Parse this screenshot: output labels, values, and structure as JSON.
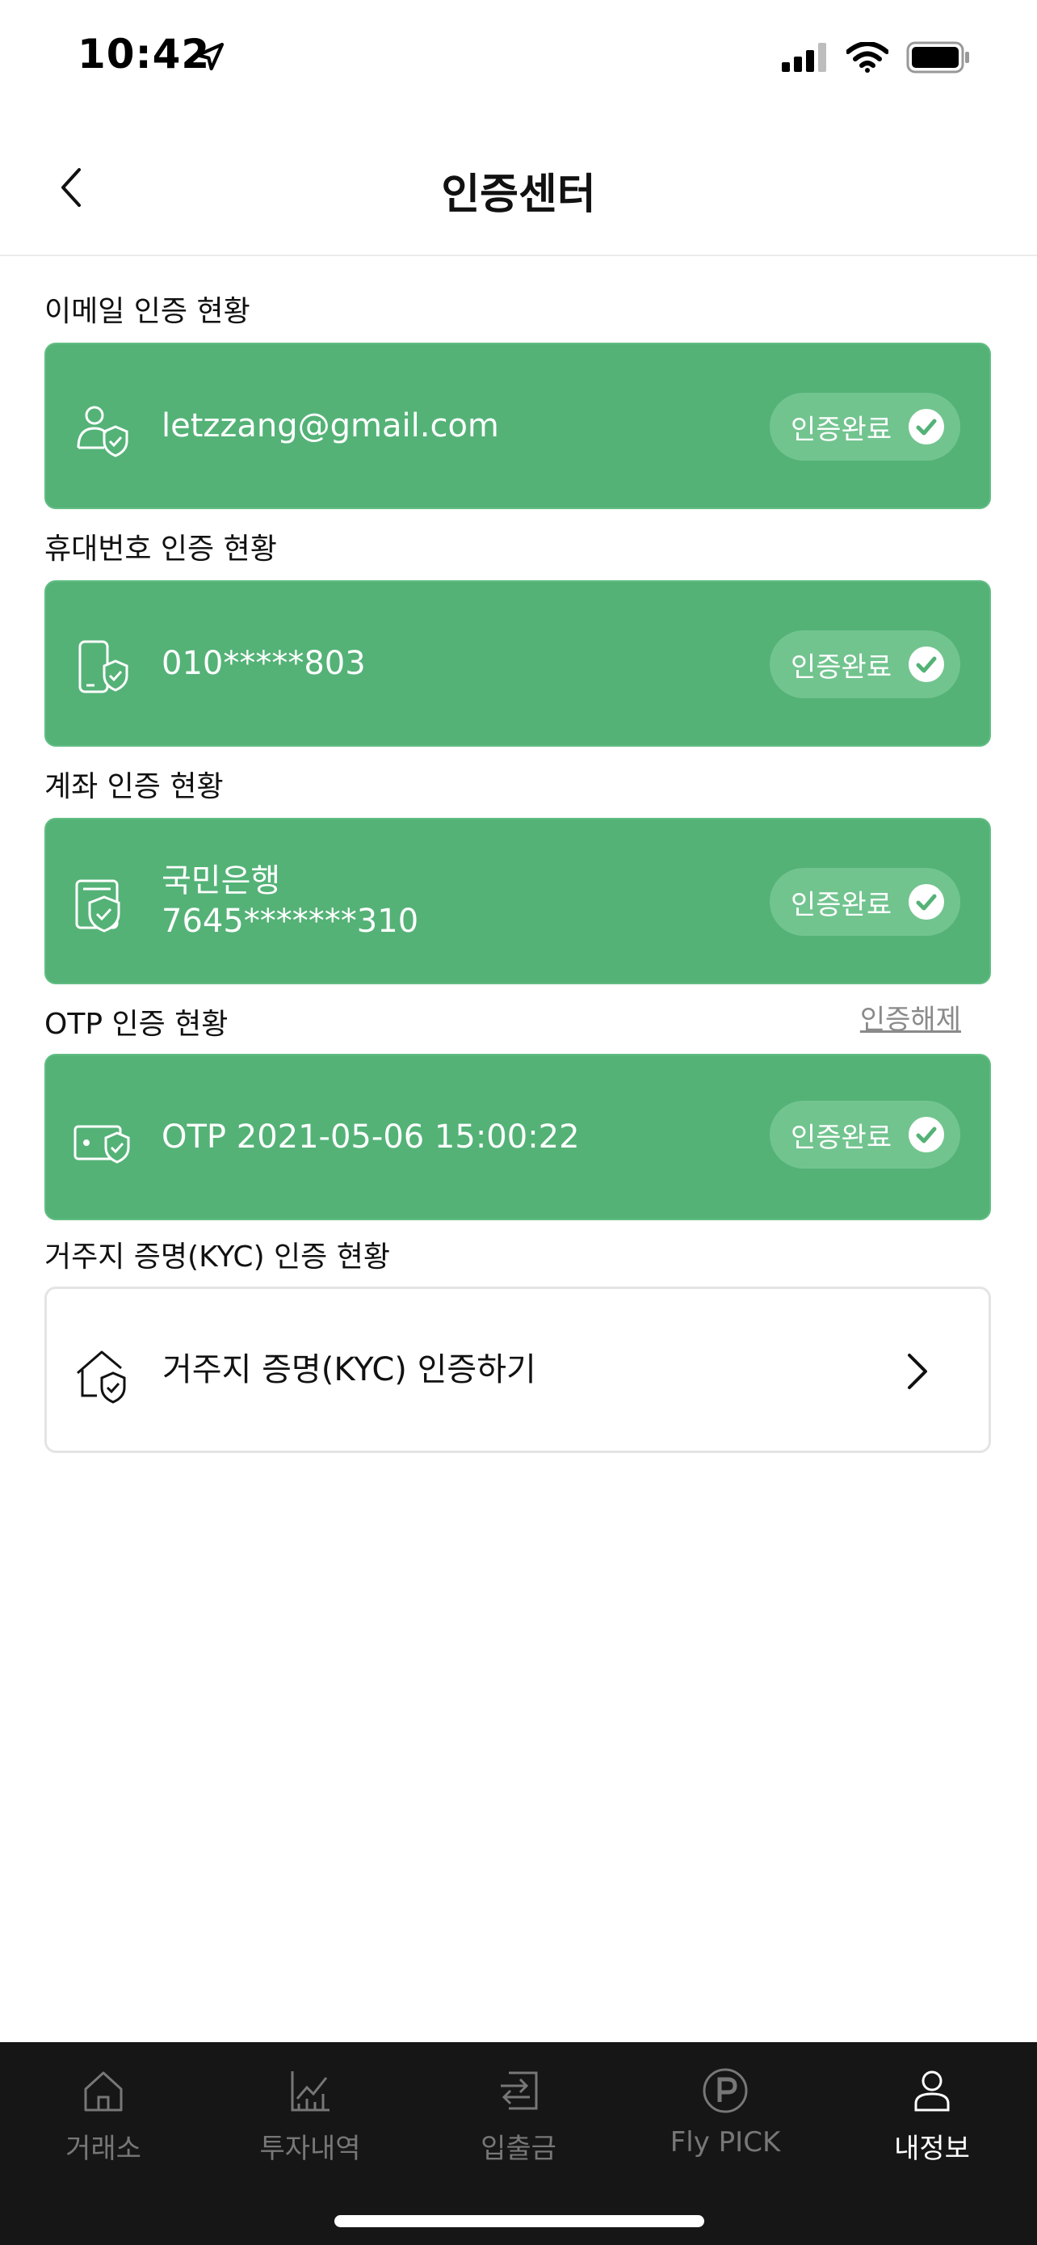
{
  "status_bar": {
    "time": "10:42"
  },
  "header": {
    "title": "인증센터"
  },
  "sections": {
    "email": {
      "label": "이메일 인증 현황",
      "value": "letzzang@gmail.com",
      "badge": "인증완료"
    },
    "phone": {
      "label": "휴대번호 인증 현황",
      "value": "010*****803",
      "badge": "인증완료"
    },
    "account": {
      "label": "계좌 인증 현황",
      "bank": "국민은행",
      "number": "7645*******310",
      "badge": "인증완료"
    },
    "otp": {
      "label": "OTP 인증 현황",
      "unlink": "인증해제",
      "value": "OTP 2021-05-06 15:00:22",
      "badge": "인증완료"
    },
    "kyc": {
      "label": "거주지 증명(KYC) 인증 현황",
      "action": "거주지 증명(KYC) 인증하기"
    }
  },
  "tabbar": {
    "items": [
      {
        "label": "거래소",
        "icon": "home-icon"
      },
      {
        "label": "투자내역",
        "icon": "chart-icon"
      },
      {
        "label": "입출금",
        "icon": "transfer-icon"
      },
      {
        "label": "Fly PICK",
        "icon": "p-circle-icon"
      },
      {
        "label": "내정보",
        "icon": "user-icon"
      }
    ],
    "active": "내정보"
  },
  "colors": {
    "verified_green": "#54b277",
    "badge_green": "#72c48f",
    "tabbar_bg": "#161616"
  }
}
